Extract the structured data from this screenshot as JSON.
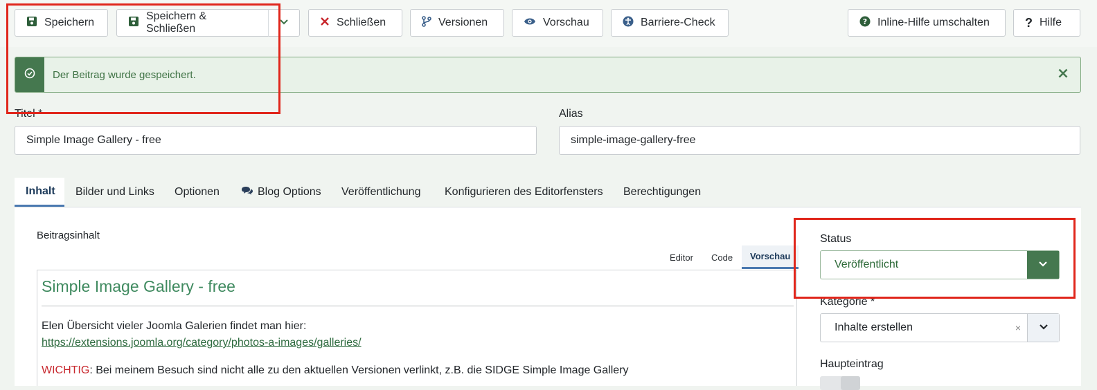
{
  "toolbar": {
    "save": "Speichern",
    "save_close": "Speichern & Schließen",
    "close": "Schließen",
    "versions": "Versionen",
    "preview": "Vorschau",
    "accessibility": "Barriere-Check",
    "inline_help": "Inline-Hilfe umschalten",
    "help": "Hilfe"
  },
  "alert": {
    "message": "Der Beitrag wurde gespeichert."
  },
  "fields": {
    "title_label": "Titel *",
    "title_value": "Simple Image Gallery - free",
    "alias_label": "Alias",
    "alias_value": "simple-image-gallery-free"
  },
  "tabs": [
    {
      "label": "Inhalt"
    },
    {
      "label": "Bilder und Links"
    },
    {
      "label": "Optionen"
    },
    {
      "label": "Blog Options"
    },
    {
      "label": "Veröffentlichung"
    },
    {
      "label": "Konfigurieren des Editorfensters"
    },
    {
      "label": "Berechtigungen"
    }
  ],
  "content": {
    "label": "Beitragsinhalt",
    "editor_tabs": [
      "Editor",
      "Code",
      "Vorschau"
    ],
    "preview_title": "Simple Image Gallery - free",
    "line1": "Elen Übersicht vieler Joomla Galerien findet man hier:",
    "link": "https://extensions.joomla.org/category/photos-a-images/galleries/",
    "warn_word": "WICHTIG",
    "warn_rest": ": Bei meinem Besuch sind nicht alle zu den aktuellen Versionen verlinkt, z.B. die SIDGE Simple Image Gallery"
  },
  "sidebar": {
    "status_label": "Status",
    "status_value": "Veröffentlicht",
    "category_label": "Kategorie *",
    "category_value": "Inhalte erstellen",
    "clear_glyph": "×",
    "featured_label": "Haupteintrag"
  },
  "colors": {
    "accent_green": "#45784f",
    "link_blue": "#4a79b0",
    "annotation_red": "#e0261b",
    "warning_red": "#c8282e"
  }
}
